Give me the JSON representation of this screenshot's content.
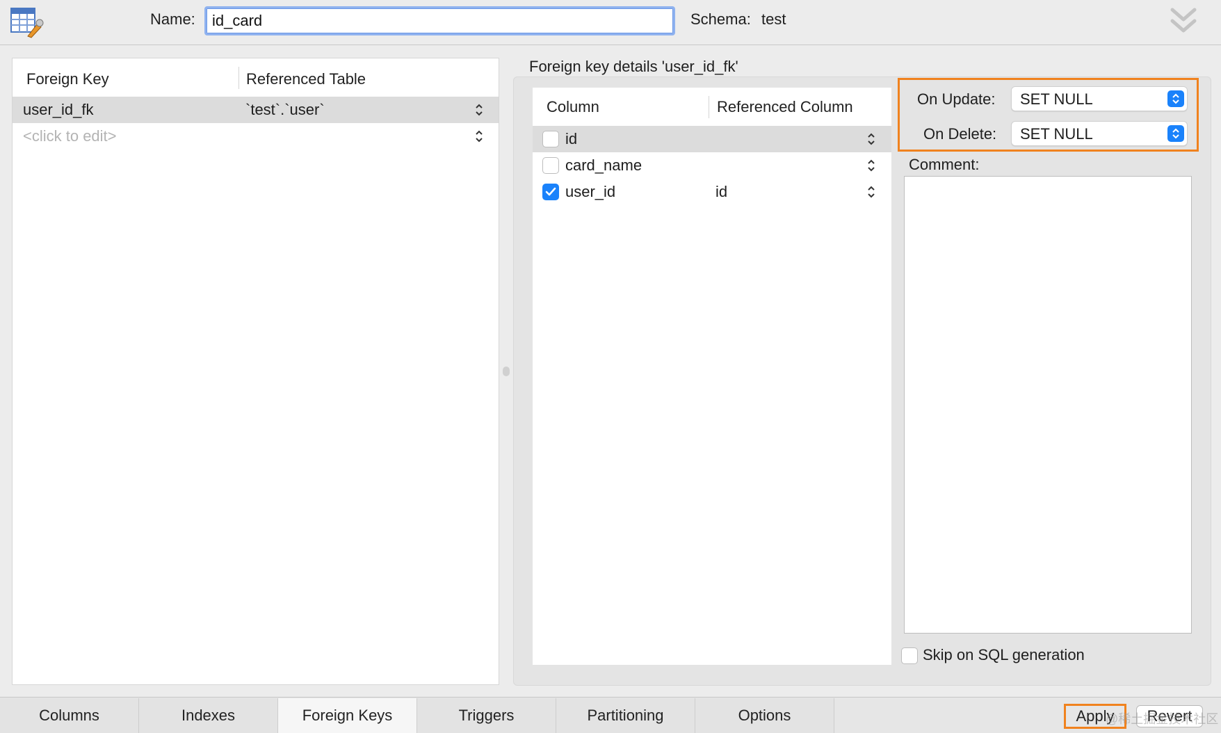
{
  "header": {
    "name_label": "Name:",
    "name_value": "id_card",
    "schema_label": "Schema:",
    "schema_value": "test"
  },
  "fk_table": {
    "headers": [
      "Foreign Key",
      "Referenced Table"
    ],
    "rows": [
      {
        "key": "user_id_fk",
        "table": "`test`.`user`",
        "selected": true
      }
    ],
    "placeholder": "<click to edit>"
  },
  "details": {
    "title": "Foreign key details 'user_id_fk'",
    "headers": [
      "Column",
      "Referenced Column"
    ],
    "columns": [
      {
        "name": "id",
        "checked": false,
        "ref": "",
        "selected": true
      },
      {
        "name": "card_name",
        "checked": false,
        "ref": "",
        "selected": false
      },
      {
        "name": "user_id",
        "checked": true,
        "ref": "id",
        "selected": false
      }
    ]
  },
  "options": {
    "on_update_label": "On Update:",
    "on_update_value": "SET NULL",
    "on_delete_label": "On Delete:",
    "on_delete_value": "SET NULL",
    "comment_label": "Comment:",
    "skip_label": "Skip on SQL generation",
    "skip_checked": false
  },
  "tabs": [
    {
      "label": "Columns",
      "active": false
    },
    {
      "label": "Indexes",
      "active": false
    },
    {
      "label": "Foreign Keys",
      "active": true
    },
    {
      "label": "Triggers",
      "active": false
    },
    {
      "label": "Partitioning",
      "active": false
    },
    {
      "label": "Options",
      "active": false
    }
  ],
  "actions": {
    "apply_label": "Apply",
    "revert_label": "Revert"
  },
  "watermark": "@稀土掘金技术社区",
  "colors": {
    "accent_blue": "#1a82fb",
    "highlight_orange": "#f0821e"
  }
}
